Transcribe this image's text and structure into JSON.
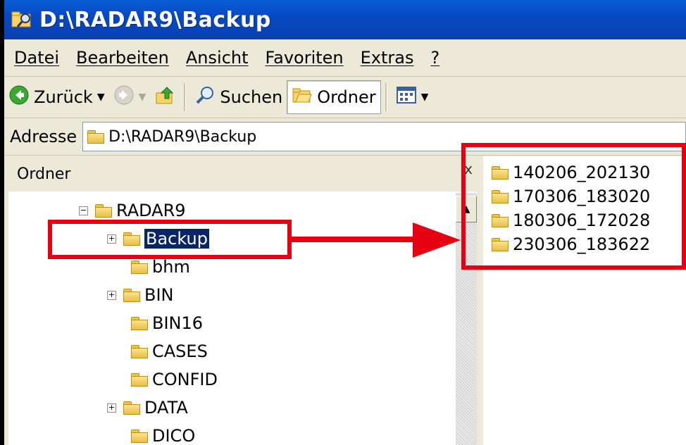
{
  "window": {
    "title": "D:\\RADAR9\\Backup"
  },
  "menu": [
    "Datei",
    "Bearbeiten",
    "Ansicht",
    "Favoriten",
    "Extras",
    "?"
  ],
  "toolbar": {
    "back": "Zurück",
    "search": "Suchen",
    "folders": "Ordner"
  },
  "address": {
    "label": "Adresse",
    "value": "D:\\RADAR9\\Backup"
  },
  "left_pane": {
    "title": "Ordner",
    "close": "x"
  },
  "tree": [
    {
      "label": "RADAR9",
      "expander": "−"
    },
    {
      "label": "Backup",
      "expander": "+"
    },
    {
      "label": "bhm",
      "expander": ""
    },
    {
      "label": "BIN",
      "expander": "+"
    },
    {
      "label": "BIN16",
      "expander": ""
    },
    {
      "label": "CASES",
      "expander": ""
    },
    {
      "label": "CONFID",
      "expander": ""
    },
    {
      "label": "DATA",
      "expander": "+"
    },
    {
      "label": "DICO",
      "expander": ""
    }
  ],
  "files": [
    "140206_202130",
    "170306_183020",
    "180306_172028",
    "230306_183622"
  ],
  "colors": {
    "highlight": "#e60012",
    "selection": "#0a246a",
    "titlebar": "#0649c4"
  },
  "icons": {
    "folder": "folder-icon",
    "back": "back-arrow-icon",
    "forward": "forward-arrow-icon",
    "up": "folder-up-icon",
    "search": "search-icon",
    "folders": "folders-icon",
    "views": "views-icon"
  }
}
